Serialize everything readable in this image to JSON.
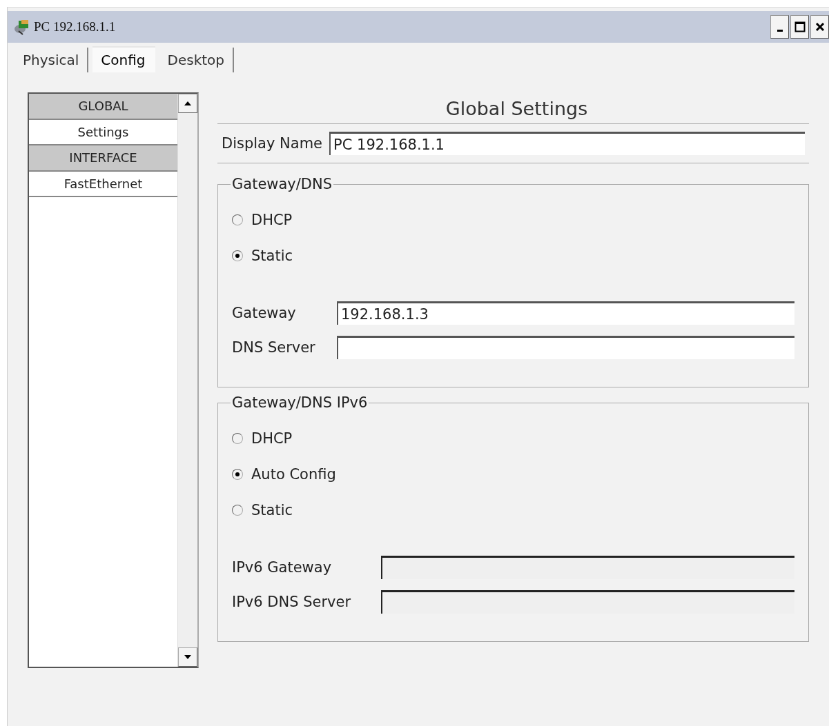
{
  "window": {
    "title": "PC 192.168.1.1"
  },
  "tabs": [
    {
      "label": "Physical",
      "selected": false
    },
    {
      "label": "Config",
      "selected": true
    },
    {
      "label": "Desktop",
      "selected": false
    }
  ],
  "sidebar": {
    "items": [
      {
        "label": "GLOBAL",
        "kind": "header"
      },
      {
        "label": "Settings",
        "kind": "item"
      },
      {
        "label": "INTERFACE",
        "kind": "header"
      },
      {
        "label": "FastEthernet",
        "kind": "item"
      }
    ]
  },
  "panel": {
    "title": "Global Settings",
    "display_name": {
      "label": "Display Name",
      "value": "PC 192.168.1.1"
    },
    "groups": [
      {
        "title": "Gateway/DNS",
        "options": [
          {
            "label": "DHCP",
            "selected": false
          },
          {
            "label": "Static",
            "selected": true
          }
        ],
        "fields": [
          {
            "label": "Gateway",
            "value": "192.168.1.3",
            "disabled": false
          },
          {
            "label": "DNS Server",
            "disabled": false
          }
        ]
      },
      {
        "title": "Gateway/DNS IPv6",
        "options": [
          {
            "label": "DHCP",
            "selected": false
          },
          {
            "label": "Auto Config",
            "selected": true
          },
          {
            "label": "Static",
            "selected": false
          }
        ],
        "fields": [
          {
            "label": "IPv6 Gateway",
            "disabled": true
          },
          {
            "label": "IPv6 DNS Server",
            "disabled": true
          }
        ]
      }
    ]
  }
}
